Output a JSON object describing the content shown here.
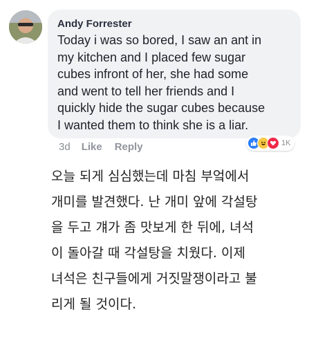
{
  "comment": {
    "author": "Andy Forrester",
    "text": "Today i was so bored, I saw an ant in\nmy kitchen and I placed few sugar\ncubes infront of her, she had some\nand went to tell her friends and I\nquickly hide the sugar cubes because\nI wanted them to think she is a liar.",
    "time": "3d",
    "like_label": "Like",
    "reply_label": "Reply",
    "reaction_count": "1K",
    "reaction_icons": [
      "like-reaction-icon",
      "haha-reaction-icon",
      "love-reaction-icon"
    ],
    "colors": {
      "bubble": "#f1f2f4",
      "like": "#2d7ff9",
      "haha": "#f7c945",
      "love": "#f0284a"
    }
  },
  "translation": {
    "text": "오늘 되게 심심했는데 마침 부엌에서\n개미를 발견했다. 난 개미 앞에 각설탕\n을 두고 걔가 좀 맛보게 한 뒤에, 녀석\n이 돌아갈 때 각설탕을 치웠다. 이제\n녀석은 친구들에게 거짓말쟁이라고 불\n리게 될 것이다."
  }
}
